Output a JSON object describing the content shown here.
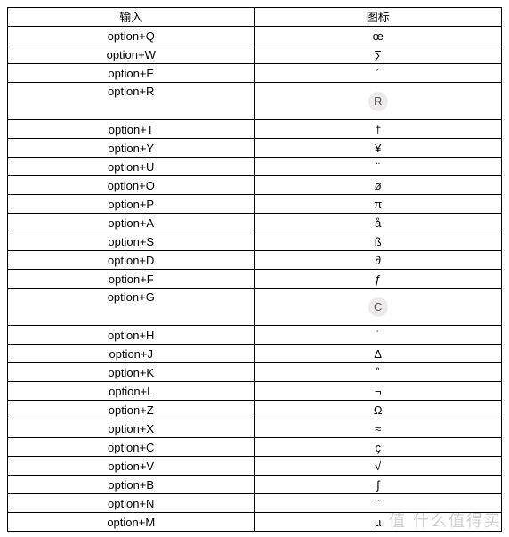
{
  "table": {
    "headers": {
      "input": "输入",
      "icon": "图标"
    },
    "rows": [
      {
        "input": "option+Q",
        "icon": "œ",
        "tall": false,
        "circled": false
      },
      {
        "input": "option+W",
        "icon": "∑",
        "tall": false,
        "circled": false
      },
      {
        "input": "option+E",
        "icon": "´",
        "tall": false,
        "circled": false
      },
      {
        "input": "option+R",
        "icon": "R",
        "tall": true,
        "circled": true
      },
      {
        "input": "option+T",
        "icon": "†",
        "tall": false,
        "circled": false
      },
      {
        "input": "option+Y",
        "icon": "¥",
        "tall": false,
        "circled": false
      },
      {
        "input": "option+U",
        "icon": "¨",
        "tall": false,
        "circled": false
      },
      {
        "input": "option+O",
        "icon": "ø",
        "tall": false,
        "circled": false
      },
      {
        "input": "option+P",
        "icon": "π",
        "tall": false,
        "circled": false
      },
      {
        "input": "option+A",
        "icon": "å",
        "tall": false,
        "circled": false
      },
      {
        "input": "option+S",
        "icon": "ß",
        "tall": false,
        "circled": false
      },
      {
        "input": "option+D",
        "icon": "∂",
        "tall": false,
        "circled": false
      },
      {
        "input": "option+F",
        "icon": "ƒ",
        "tall": false,
        "circled": false
      },
      {
        "input": "option+G",
        "icon": "C",
        "tall": true,
        "circled": true
      },
      {
        "input": "option+H",
        "icon": "˙",
        "tall": false,
        "circled": false
      },
      {
        "input": "option+J",
        "icon": "Δ",
        "tall": false,
        "circled": false
      },
      {
        "input": "option+K",
        "icon": "˚",
        "tall": false,
        "circled": false
      },
      {
        "input": "option+L",
        "icon": "¬",
        "tall": false,
        "circled": false
      },
      {
        "input": "option+Z",
        "icon": "Ω",
        "tall": false,
        "circled": false
      },
      {
        "input": "option+X",
        "icon": "≈",
        "tall": false,
        "circled": false
      },
      {
        "input": "option+C",
        "icon": "ç",
        "tall": false,
        "circled": false
      },
      {
        "input": "option+V",
        "icon": "√",
        "tall": false,
        "circled": false
      },
      {
        "input": "option+B",
        "icon": "∫",
        "tall": false,
        "circled": false
      },
      {
        "input": "option+N",
        "icon": "˜",
        "tall": false,
        "circled": false
      },
      {
        "input": "option+M",
        "icon": "µ",
        "tall": false,
        "circled": false
      }
    ]
  },
  "watermark": "值 什么值得买"
}
